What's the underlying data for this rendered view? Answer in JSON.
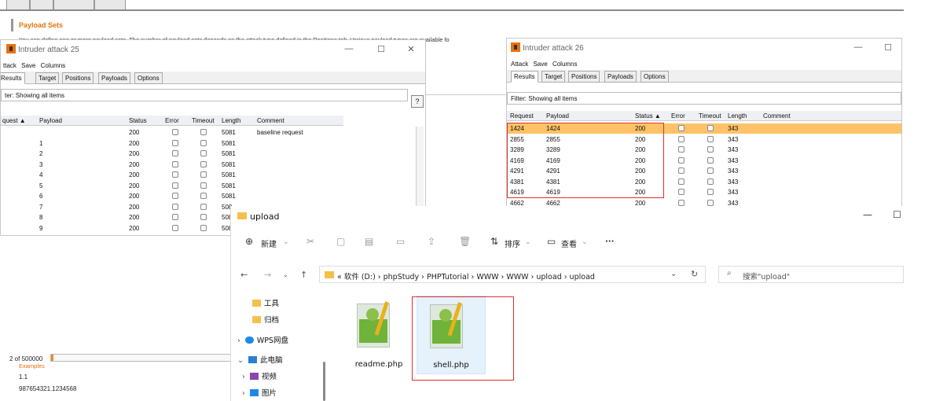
{
  "background": {
    "payload_sets_title": "Payload Sets",
    "payload_sets_desc": "You can define one or more payload sets. The number of payload sets depends on the attack type defined in the Positions tab. Various payload types are available fo",
    "request_count": "2 of 500000",
    "examples_label": "Examples",
    "example1": "1.1",
    "example2": "987654321.1234568",
    "progress": 0.003
  },
  "attack25": {
    "title": "Intruder attack 25",
    "menu": [
      "ttack",
      "Save",
      "Columns"
    ],
    "tabs": [
      "Results",
      "Target",
      "Positions",
      "Payloads",
      "Options"
    ],
    "filter": "ter: Showing all items",
    "help": "?",
    "columns": [
      "quest ▲",
      "Payload",
      "Status",
      "Error",
      "Timeout",
      "Length",
      "Comment"
    ],
    "rows": [
      {
        "payload": "",
        "status": "200",
        "length": "5081",
        "comment": "baseline request"
      },
      {
        "payload": "1",
        "status": "200",
        "length": "5081",
        "comment": ""
      },
      {
        "payload": "2",
        "status": "200",
        "length": "5081",
        "comment": ""
      },
      {
        "payload": "3",
        "status": "200",
        "length": "5081",
        "comment": ""
      },
      {
        "payload": "4",
        "status": "200",
        "length": "5081",
        "comment": ""
      },
      {
        "payload": "5",
        "status": "200",
        "length": "5081",
        "comment": ""
      },
      {
        "payload": "6",
        "status": "200",
        "length": "5081",
        "comment": ""
      },
      {
        "payload": "7",
        "status": "200",
        "length": "508",
        "comment": ""
      },
      {
        "payload": "8",
        "status": "200",
        "length": "508",
        "comment": ""
      },
      {
        "payload": "9",
        "status": "200",
        "length": "508",
        "comment": ""
      }
    ]
  },
  "attack26": {
    "title": "Intruder attack 26",
    "menu": [
      "Attack",
      "Save",
      "Columns"
    ],
    "tabs": [
      "Results",
      "Target",
      "Positions",
      "Payloads",
      "Options"
    ],
    "filter": "Filter: Showing all items",
    "columns": [
      "Request",
      "Payload",
      "Status ▲",
      "Error",
      "Timeout",
      "Length",
      "Comment"
    ],
    "rows": [
      {
        "request": "1424",
        "payload": "1424",
        "status": "200",
        "length": "343"
      },
      {
        "request": "2855",
        "payload": "2855",
        "status": "200",
        "length": "343"
      },
      {
        "request": "3289",
        "payload": "3289",
        "status": "200",
        "length": "343"
      },
      {
        "request": "4169",
        "payload": "4169",
        "status": "200",
        "length": "343"
      },
      {
        "request": "4291",
        "payload": "4291",
        "status": "200",
        "length": "343"
      },
      {
        "request": "4381",
        "payload": "4381",
        "status": "200",
        "length": "343"
      },
      {
        "request": "4619",
        "payload": "4619",
        "status": "200",
        "length": "343"
      },
      {
        "request": "4662",
        "payload": "4662",
        "status": "200",
        "length": "343"
      }
    ]
  },
  "explorer": {
    "title": "upload",
    "toolbar": {
      "new": "新建",
      "sort": "排序",
      "view": "查看",
      "more": "···"
    },
    "path": "« 软件 (D:) › phpStudy › PHPTutorial › WWW › WWW › upload › upload",
    "search_placeholder": "搜索\"upload\"",
    "sidebar": [
      "工具",
      "归档",
      "WPS网盘",
      "此电脑",
      "视频",
      "图片"
    ],
    "files": [
      "readme.php",
      "shell.php"
    ],
    "colors": {
      "folder": "#f5c04a",
      "selection": "#e5f1fb",
      "highlight_box": "#e03030"
    }
  },
  "colors": {
    "burp_orange": "#e8720c",
    "row_highlight": "#ffc266"
  }
}
